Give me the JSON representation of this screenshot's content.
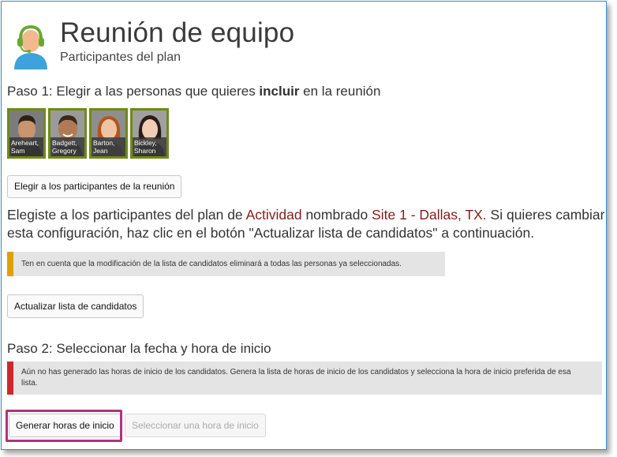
{
  "header": {
    "title": "Reunión de equipo",
    "subtitle": "Participantes del plan",
    "icon": "support-agent-icon"
  },
  "step1": {
    "heading_pre": "Paso 1: Elegir a las personas que quieres ",
    "heading_bold": "incluir",
    "heading_post": " en la reunión",
    "participants": [
      {
        "name": "Areheart, Sam"
      },
      {
        "name": "Badgett, Gregory"
      },
      {
        "name": "Barton, Jean"
      },
      {
        "name": "Bickley, Sharon"
      }
    ],
    "choose_button": "Elegir a los participantes de la reunión"
  },
  "info": {
    "part1": "Elegiste a los participantes del plan de ",
    "activity_label": "Actividad",
    "part2": " nombrado ",
    "site_label": "Site 1 - Dallas, TX.",
    "part3": " Si quieres cambiar esta configuración, haz clic en el botón \"Actualizar lista de candidatos\" a continuación."
  },
  "warning": {
    "text": "Ten en cuenta que la modificación de la lista de candidatos eliminará a todas las personas ya seleccionadas."
  },
  "update_button": "Actualizar lista de candidatos",
  "step2": {
    "heading": "Paso 2: Seleccionar la fecha y hora de inicio",
    "error_text": "Aún no has generado las horas de inicio de los candidatos. Genera la lista de horas de inicio de los candidatos y selecciona la hora de inicio preferida de esa lista.",
    "generate_button": "Generar horas de inicio",
    "select_button": "Seleccionar una hora de inicio"
  },
  "colors": {
    "frame_border": "#2f8fd0",
    "photo_border": "#6f8a18",
    "highlight_text": "#8b1a1a",
    "warning_bar": "#e0a000",
    "error_bar": "#cc2a2a",
    "callout": "#b0327f"
  }
}
